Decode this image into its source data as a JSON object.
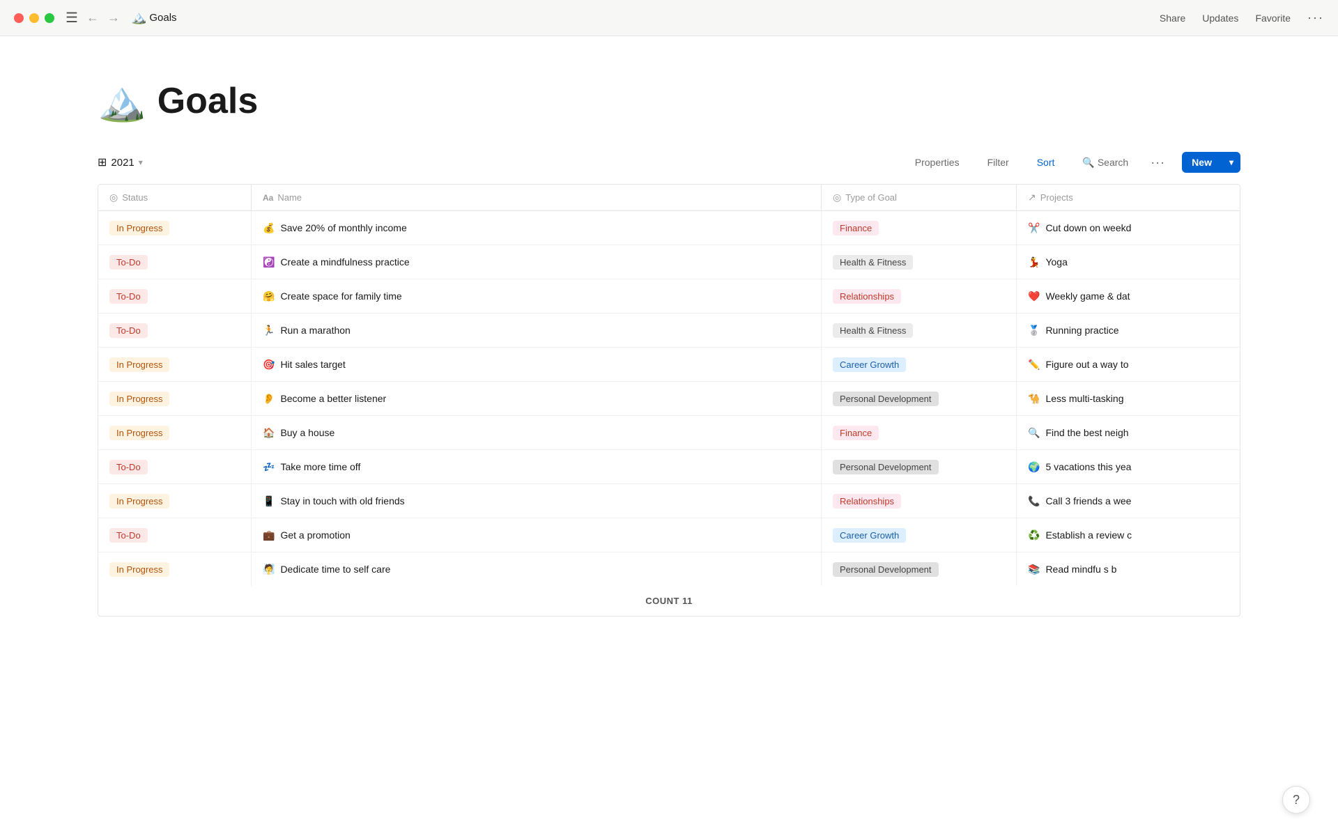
{
  "titlebar": {
    "title": "Goals",
    "page_icon": "🏔️",
    "nav": {
      "back_label": "←",
      "forward_label": "→",
      "menu_label": "☰"
    },
    "actions": {
      "share": "Share",
      "updates": "Updates",
      "favorite": "Favorite",
      "more": "···"
    }
  },
  "page": {
    "emoji": "🏔️",
    "title": "Goals"
  },
  "toolbar": {
    "view_icon": "⊞",
    "view_label": "2021",
    "properties": "Properties",
    "filter": "Filter",
    "sort": "Sort",
    "search_icon": "🔍",
    "search": "Search",
    "more": "···",
    "new_label": "New",
    "chevron": "▾"
  },
  "table": {
    "columns": [
      {
        "icon": "◎",
        "label": "Status"
      },
      {
        "icon": "Aa",
        "label": "Name"
      },
      {
        "icon": "◎",
        "label": "Type of Goal"
      },
      {
        "icon": "↗",
        "label": "Projects"
      }
    ],
    "rows": [
      {
        "status": "In Progress",
        "status_type": "inprogress",
        "emoji": "💰",
        "name": "Save 20% of monthly income",
        "goal_type": "Finance",
        "goal_class": "goal-finance",
        "project_emoji": "✂️",
        "project": "Cut down on weekd"
      },
      {
        "status": "To-Do",
        "status_type": "todo",
        "emoji": "☯️",
        "name": "Create a mindfulness practice",
        "goal_type": "Health & Fitness",
        "goal_class": "goal-health",
        "project_emoji": "💃",
        "project": "Yoga"
      },
      {
        "status": "To-Do",
        "status_type": "todo",
        "emoji": "🤗",
        "name": "Create space for family time",
        "goal_type": "Relationships",
        "goal_class": "goal-relationships",
        "project_emoji": "❤️",
        "project": "Weekly game & dat"
      },
      {
        "status": "To-Do",
        "status_type": "todo",
        "emoji": "🏃",
        "name": "Run a marathon",
        "goal_type": "Health & Fitness",
        "goal_class": "goal-health",
        "project_emoji": "🥈",
        "project": "Running practice"
      },
      {
        "status": "In Progress",
        "status_type": "inprogress",
        "emoji": "🎯",
        "name": "Hit sales target",
        "goal_type": "Career Growth",
        "goal_class": "goal-career",
        "project_emoji": "✏️",
        "project": "Figure out a way to"
      },
      {
        "status": "In Progress",
        "status_type": "inprogress",
        "emoji": "👂",
        "name": "Become a better listener",
        "goal_type": "Personal Development",
        "goal_class": "goal-personal",
        "project_emoji": "🐪",
        "project": "Less multi-tasking"
      },
      {
        "status": "In Progress",
        "status_type": "inprogress",
        "emoji": "🏠",
        "name": "Buy a house",
        "goal_type": "Finance",
        "goal_class": "goal-finance",
        "project_emoji": "🔍",
        "project": "Find the best neigh"
      },
      {
        "status": "To-Do",
        "status_type": "todo",
        "emoji": "💤",
        "name": "Take more time off",
        "goal_type": "Personal Development",
        "goal_class": "goal-personal",
        "project_emoji": "🌍",
        "project": "5 vacations this yea"
      },
      {
        "status": "In Progress",
        "status_type": "inprogress",
        "emoji": "📱",
        "name": "Stay in touch with old friends",
        "goal_type": "Relationships",
        "goal_class": "goal-relationships",
        "project_emoji": "📞",
        "project": "Call 3 friends a wee"
      },
      {
        "status": "To-Do",
        "status_type": "todo",
        "emoji": "💼",
        "name": "Get a promotion",
        "goal_type": "Career Growth",
        "goal_class": "goal-career",
        "project_emoji": "♻️",
        "project": "Establish a review c"
      },
      {
        "status": "In Progress",
        "status_type": "inprogress",
        "emoji": "🧖",
        "name": "Dedicate time to self care",
        "goal_type": "Personal Development",
        "goal_class": "goal-personal",
        "project_emoji": "📚",
        "project": "Read mindfu  s b"
      }
    ],
    "footer": {
      "count_label": "COUNT",
      "count": "11"
    }
  },
  "help": {
    "label": "?"
  }
}
